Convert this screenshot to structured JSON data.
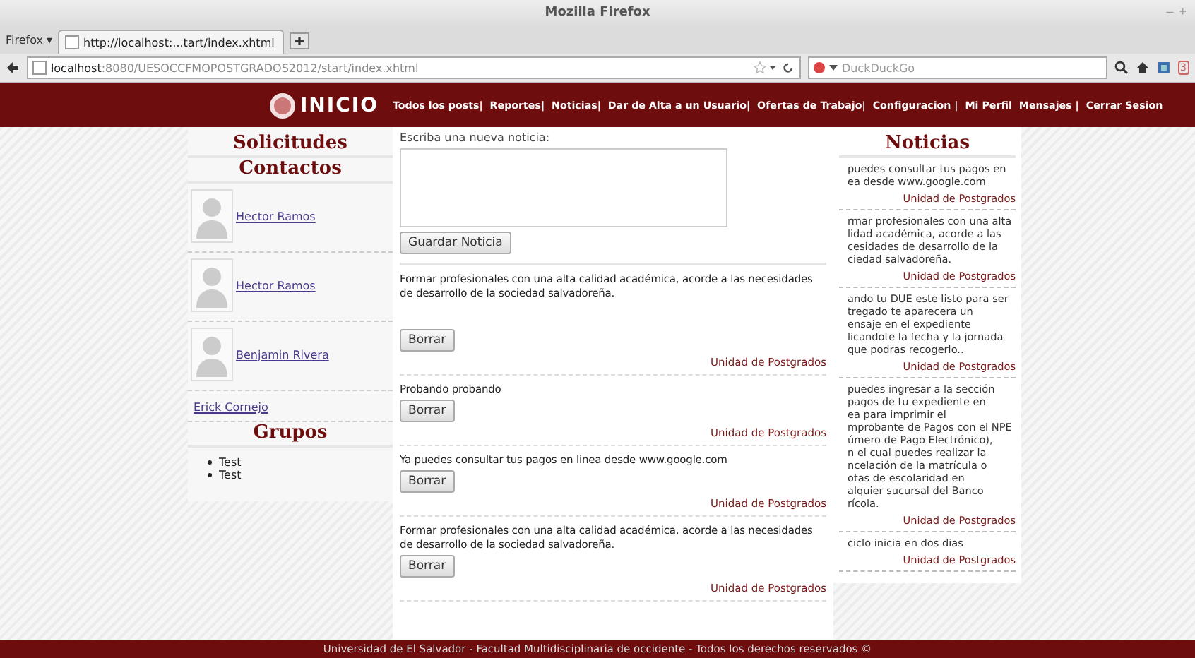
{
  "window": {
    "title": "Mozilla Firefox",
    "controls": [
      "–",
      "+"
    ]
  },
  "browser": {
    "menu": "Firefox ▾",
    "tab": "http://localhost:...tart/index.xhtml",
    "url_host": "localhost",
    "url_rest": ":8080/UESOCCFMOPOSTGRADOS2012/start/index.xhtml",
    "search_placeholder": "DuckDuckGo",
    "badge": "3"
  },
  "header": {
    "logo": "INICIO",
    "nav": [
      "Todos los posts|",
      "Reportes|",
      "Noticias|",
      "Dar de Alta a un Usuario|",
      "Ofertas de Trabajo|",
      "Configuracion |",
      "Mi Perfil",
      "Mensajes |",
      "Cerrar Sesion"
    ]
  },
  "left": {
    "solicitudes": "Solicitudes",
    "contactos_title": "Contactos",
    "contacts": [
      {
        "name": "Hector Ramos",
        "kind": "photo"
      },
      {
        "name": "Hector Ramos",
        "kind": "photo"
      },
      {
        "name": "Benjamin Rivera",
        "kind": "photo"
      },
      {
        "name": "Erick Cornejo",
        "kind": "plain"
      }
    ],
    "grupos_title": "Grupos",
    "groups": [
      "Test",
      "Test"
    ]
  },
  "center": {
    "prompt": "Escriba una nueva noticia:",
    "save_button": "Guardar Noticia",
    "posts": [
      {
        "text": "Formar profesionales con una alta calidad académica, acorde a las necesidades de desarrollo de la sociedad salvadoreña.",
        "button": "Borrar",
        "author": "Unidad de Postgrados",
        "spaced": true
      },
      {
        "text": "Probando probando",
        "button": "Borrar",
        "author": "Unidad de Postgrados",
        "spaced": false
      },
      {
        "text": "Ya puedes consultar tus pagos en linea desde www.google.com",
        "button": "Borrar",
        "author": "Unidad de Postgrados",
        "spaced": false
      },
      {
        "text": "Formar profesionales con una alta calidad académica, acorde a las necesidades de desarrollo de la sociedad salvadoreña.",
        "button": "Borrar",
        "author": "Unidad de Postgrados",
        "spaced": false
      }
    ]
  },
  "right": {
    "title": "Noticias",
    "items": [
      {
        "lines": [
          "puedes consultar tus pagos en",
          "ea desde www.google.com"
        ],
        "author": "Unidad de Postgrados"
      },
      {
        "lines": [
          "rmar profesionales con una alta",
          "lidad académica, acorde a las",
          "cesidades de desarrollo de la",
          "ciedad salvadoreña."
        ],
        "author": "Unidad de Postgrados"
      },
      {
        "lines": [
          "ando tu DUE este listo para ser",
          "tregado te aparecera un",
          "ensaje en el expediente",
          "licandote la fecha y la jornada",
          "que podras recogerlo.."
        ],
        "author": "Unidad de Postgrados"
      },
      {
        "lines": [
          "puedes ingresar a la sección",
          "pagos de tu expediente en",
          "ea para imprimir el",
          "mprobante de Pagos con el NPE",
          "úmero de Pago Electrónico),",
          "n el cual puedes realizar la",
          "ncelación de la matrícula o",
          "otas de escolaridad en",
          "alquier sucursal del Banco",
          "rícola."
        ],
        "author": "Unidad de Postgrados"
      },
      {
        "lines": [
          "ciclo inicia en dos dias"
        ],
        "author": "Unidad de Postgrados"
      }
    ]
  },
  "footer": "Universidad de El Salvador - Facultad Multidisciplinaria de occidente - Todos los derechos reservados ©"
}
